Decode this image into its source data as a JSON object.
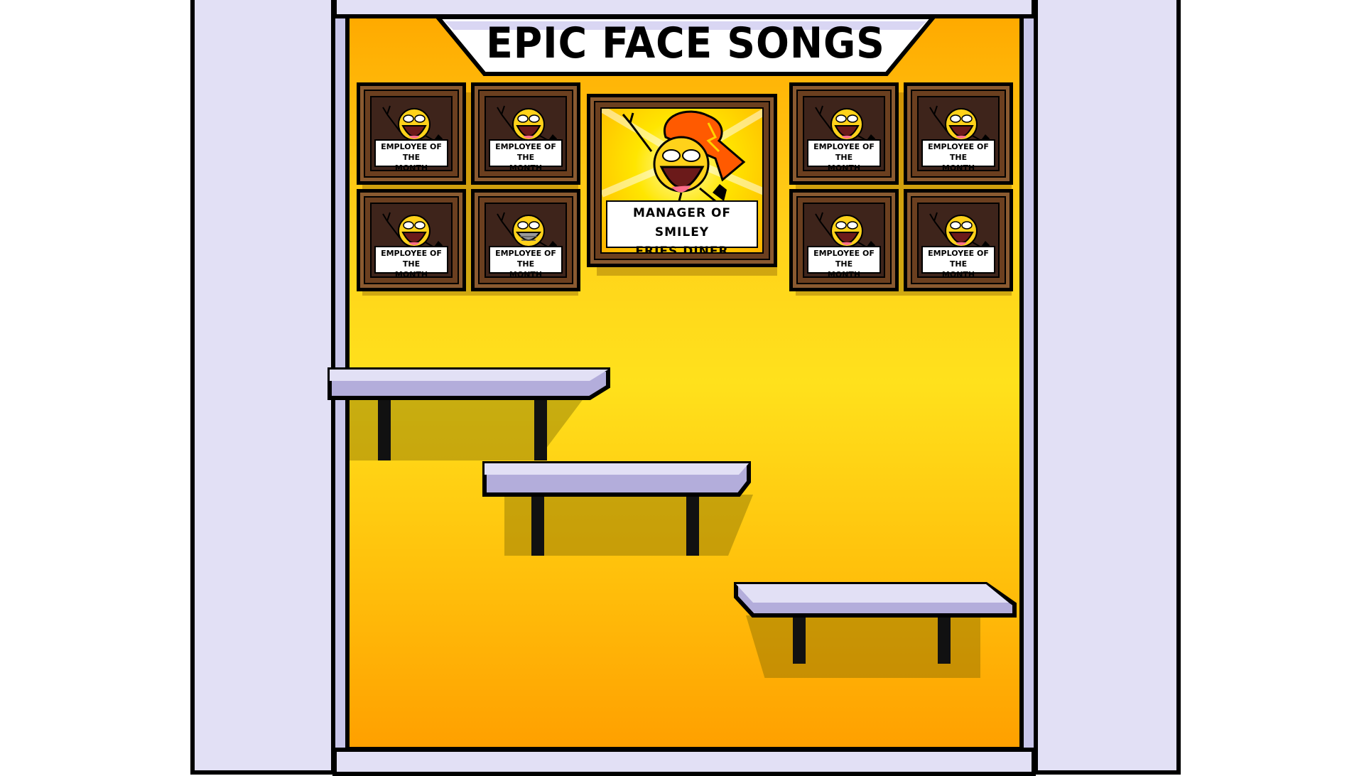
{
  "banner": {
    "title": "EPIC FACE SONGS"
  },
  "manager_portrait": {
    "caption_line1": "MANAGER OF SMILEY",
    "caption_line2": "FRIES DINER"
  },
  "employee_portraits": [
    {
      "caption_line1": "EMPLOYEE OF THE",
      "caption_line2": "MONTH",
      "face": "epic-face",
      "masked": false
    },
    {
      "caption_line1": "EMPLOYEE OF THE",
      "caption_line2": "MONTH",
      "face": "epic-face",
      "masked": false
    },
    {
      "caption_line1": "EMPLOYEE OF THE",
      "caption_line2": "MONTH",
      "face": "epic-face",
      "masked": false
    },
    {
      "caption_line1": "EMPLOYEE OF THE",
      "caption_line2": "MONTH",
      "face": "epic-face",
      "masked": true
    },
    {
      "caption_line1": "EMPLOYEE OF THE",
      "caption_line2": "MONTH",
      "face": "epic-face",
      "masked": false
    },
    {
      "caption_line1": "EMPLOYEE OF THE",
      "caption_line2": "MONTH",
      "face": "epic-face",
      "masked": false
    },
    {
      "caption_line1": "EMPLOYEE OF THE",
      "caption_line2": "MONTH",
      "face": "epic-face",
      "masked": false
    },
    {
      "caption_line1": "EMPLOYEE OF THE",
      "caption_line2": "MONTH",
      "face": "epic-face",
      "masked": false
    }
  ],
  "colors": {
    "wall_top": "#ffaa00",
    "wall_mid": "#ffe11c",
    "frame_wood": "#6b3f1f",
    "side_wall": "#e2e0f5",
    "shelf_top": "#e2e0f5",
    "shelf_side": "#b3addb"
  },
  "icons": [
    "epic-face-icon",
    "flame-hair-icon",
    "peace-sign-icon",
    "thumbs-up-icon"
  ]
}
